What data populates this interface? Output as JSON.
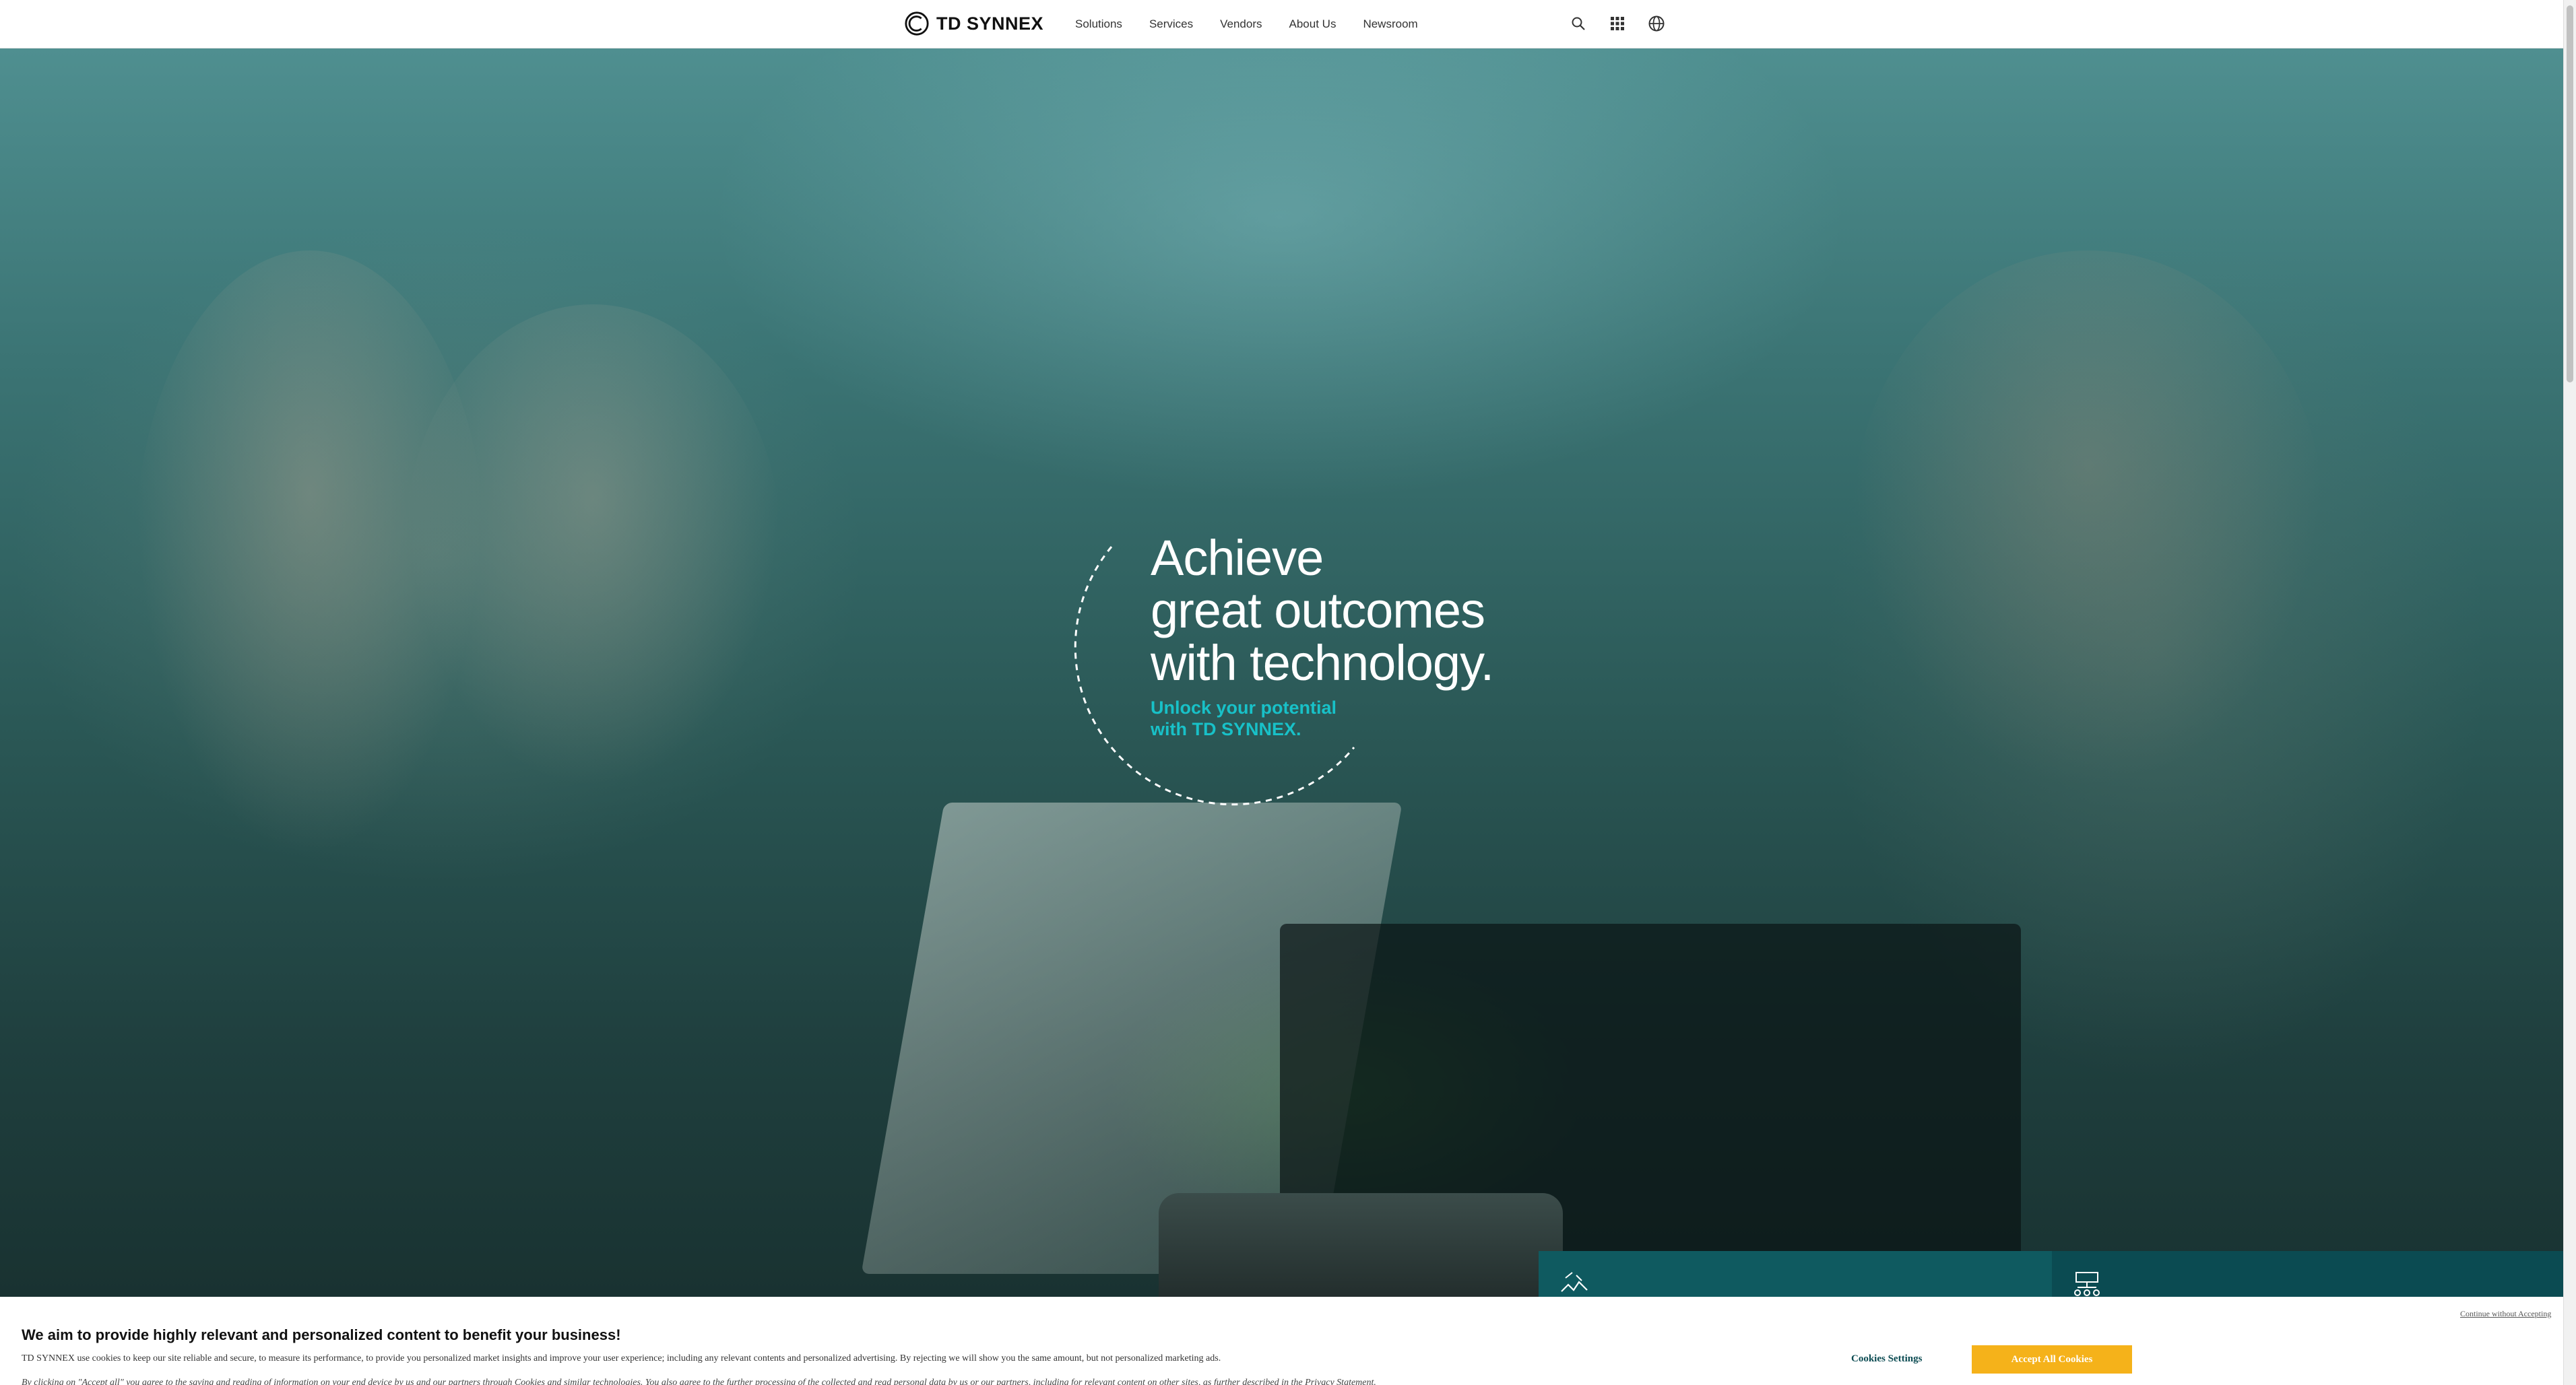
{
  "header": {
    "logo_text": "TD SYNNEX",
    "nav": [
      {
        "label": "Solutions"
      },
      {
        "label": "Services"
      },
      {
        "label": "Vendors"
      },
      {
        "label": "About Us"
      },
      {
        "label": "Newsroom"
      }
    ],
    "icons": [
      "search-icon",
      "apps-grid-icon",
      "globe-icon"
    ]
  },
  "hero": {
    "title_lines": [
      "Achieve",
      "great outcomes",
      "with technology."
    ],
    "subtitle_lines": [
      "Unlock your potential",
      "with TD SYNNEX."
    ],
    "accent_color": "#18c1c8"
  },
  "cards": [
    {
      "icon": "handshake-icon",
      "color": "#0f5a60"
    },
    {
      "icon": "network-server-icon",
      "color": "#0b4b52"
    }
  ],
  "cookie": {
    "title": "We aim to provide highly relevant and personalized content to benefit your business!",
    "body": "TD SYNNEX use cookies to keep our site reliable and secure, to measure its performance, to provide you personalized market insights and improve your user experience; including any relevant contents and personalized advertising. By rejecting we will show you the same amount, but not personalized marketing ads.",
    "body2": "By clicking on \"Accept all\" you agree to the saving and reading of information on your end device by us and our partners through Cookies and similar technologies. You also agree to the further processing of the collected and read personal data by us or our partners, including for relevant content on other sites, as further described in the Privacy Statement.",
    "continue_label": "Continue without Accepting",
    "settings_label": "Cookies Settings",
    "accept_label": "Accept All Cookies",
    "accept_color": "#f5b21a"
  }
}
